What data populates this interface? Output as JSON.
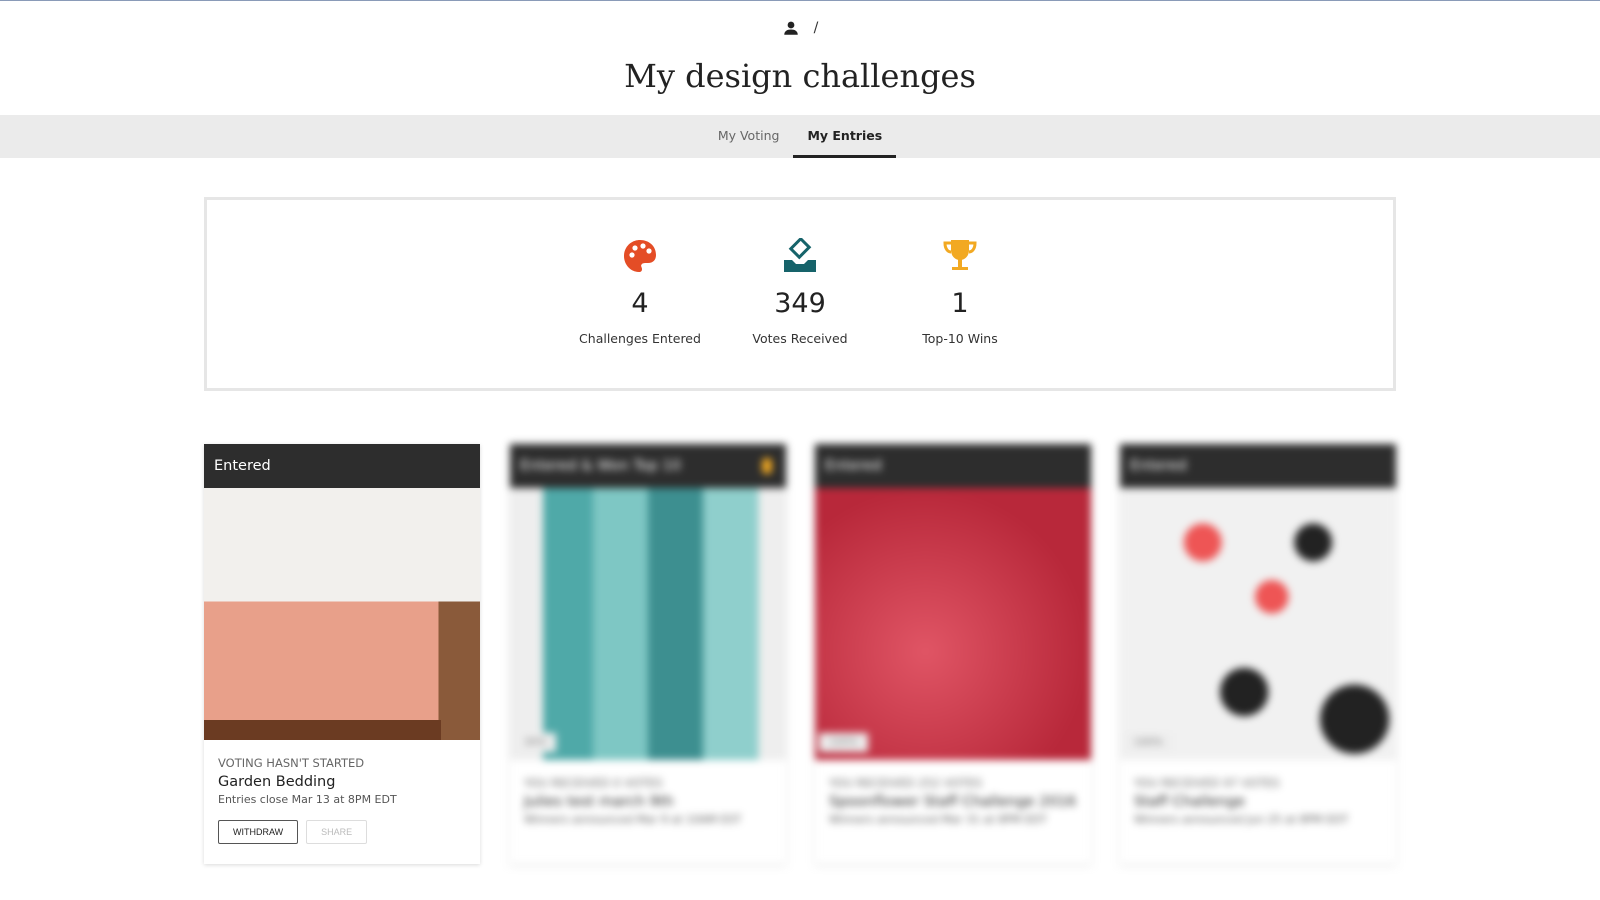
{
  "breadcrumb": {
    "separator": "/",
    "icon": "user-icon"
  },
  "page_title": "My design challenges",
  "tabs": [
    {
      "label": "My Voting",
      "active": false
    },
    {
      "label": "My Entries",
      "active": true
    }
  ],
  "stats": [
    {
      "icon": "palette-icon",
      "color": "#e44d26",
      "value": "4",
      "label": "Challenges Entered"
    },
    {
      "icon": "ballot-box-icon",
      "color": "#16636a",
      "value": "349",
      "label": "Votes Received"
    },
    {
      "icon": "trophy-icon",
      "color": "#f2a922",
      "value": "1",
      "label": "Top-10 Wins"
    }
  ],
  "cards": [
    {
      "header": "Entered",
      "status": "VOTING HASN'T STARTED",
      "title": "Garden Bedding",
      "subtitle": "Entries close Mar 13 at 8PM EDT",
      "withdraw": "WITHDRAW",
      "share": "SHARE"
    },
    {
      "header": "Entered & Won Top 10",
      "status": "YOU RECEIVED 0 VOTES",
      "title": "Julies test march 9th",
      "subtitle": "Winners announced Mar 9 at 10AM EST",
      "tag": "30%"
    },
    {
      "header": "Entered",
      "status": "YOU RECEIVED 252 VOTES",
      "title": "Spoonflower Staff Challenge 2016",
      "subtitle": "Winners announced Mar 31 at 8PM EDT",
      "tag": "100%"
    },
    {
      "header": "Entered",
      "status": "YOU RECEIVED 97 VOTES",
      "title": "Staff Challenge",
      "subtitle": "Winners announced Jun 25 at 8PM EDT",
      "tag": "100%"
    }
  ]
}
